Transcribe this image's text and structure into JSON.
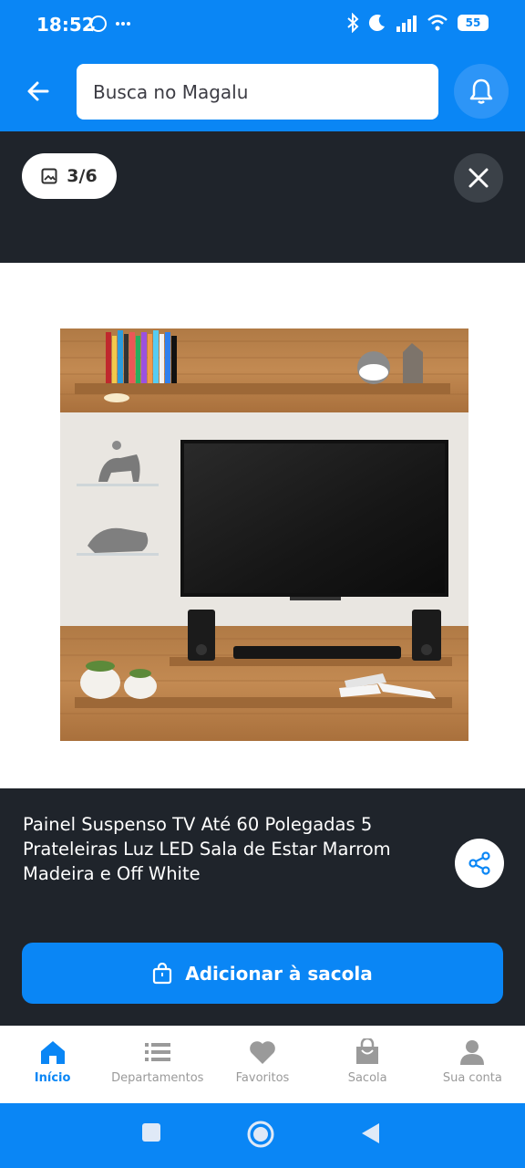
{
  "status_bar": {
    "time": "18:52",
    "battery": "55"
  },
  "header": {
    "search_placeholder": "Busca no Magalu"
  },
  "viewer": {
    "counter": "3/6"
  },
  "product": {
    "title": "Painel Suspenso TV Até 60 Polegadas 5 Prateleiras Luz LED Sala de Estar Marrom Madeira e Off White"
  },
  "actions": {
    "add_to_bag": "Adicionar à sacola"
  },
  "bottom_nav": {
    "items": [
      {
        "label": "Início",
        "icon": "home-icon",
        "active": true
      },
      {
        "label": "Departamentos",
        "icon": "list-icon",
        "active": false
      },
      {
        "label": "Favoritos",
        "icon": "heart-icon",
        "active": false
      },
      {
        "label": "Sacola",
        "icon": "bag-icon",
        "active": false
      },
      {
        "label": "Sua conta",
        "icon": "user-icon",
        "active": false
      }
    ]
  },
  "colors": {
    "brand": "#0a86f5",
    "dark_bg": "#1f242b",
    "inactive": "#9a9a9a"
  }
}
